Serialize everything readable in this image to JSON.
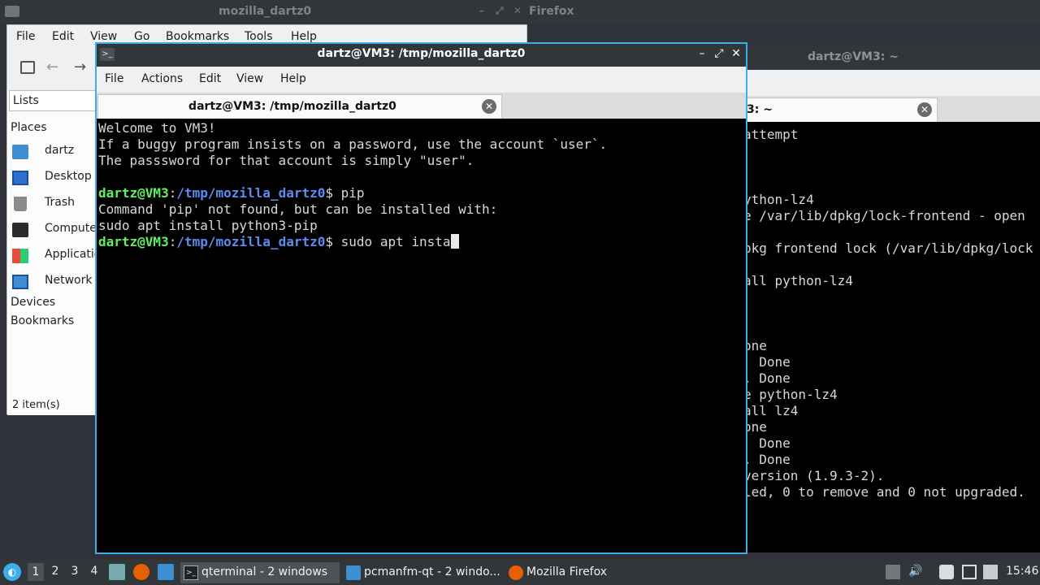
{
  "firefox": {
    "title": "mozilla_dartz0",
    "title_tail": "Firefox"
  },
  "file_manager": {
    "menu": [
      "File",
      "Edit",
      "View",
      "Go",
      "Bookmarks",
      "Tools",
      "Help"
    ],
    "sidebar_mode": "Lists",
    "places_header": "Places",
    "places": [
      {
        "label": "dartz",
        "icon": "home-folder-icon"
      },
      {
        "label": "Desktop",
        "icon": "desktop-icon"
      },
      {
        "label": "Trash",
        "icon": "trash-icon"
      },
      {
        "label": "Compute",
        "icon": "computer-icon"
      },
      {
        "label": "Applicatio",
        "icon": "applications-icon"
      },
      {
        "label": "Network",
        "icon": "network-icon"
      }
    ],
    "devices_header": "Devices",
    "bookmarks_header": "Bookmarks",
    "status": "2 item(s)"
  },
  "right_terminal": {
    "title": "dartz@VM3: ~",
    "tab_label": "3: ~",
    "lines": [
      {
        "text": "attempt",
        "row": 2
      },
      {
        "text": "ython-lz4",
        "row": 6
      },
      {
        "text": "e /var/lib/dpkg/lock-frontend - open",
        "row": 7
      },
      {
        "text": "pkg frontend lock (/var/lib/dpkg/lock",
        "row": 9
      },
      {
        "text": "all python-lz4",
        "row": 11
      },
      {
        "text": "one",
        "row": 15
      },
      {
        "text": "  Done",
        "row": 16
      },
      {
        "text": ". Done",
        "row": 17
      },
      {
        "text": "e python-lz4",
        "row": 18
      },
      {
        "text": "all lz4",
        "row": 19
      },
      {
        "text": "one",
        "row": 20
      },
      {
        "text": "  Done",
        "row": 21
      },
      {
        "text": ". Done",
        "row": 22
      },
      {
        "text": "version (1.9.3-2).",
        "row": 23
      },
      {
        "text": "led, 0 to remove and 0 not upgraded.",
        "row": 24
      }
    ]
  },
  "main_terminal": {
    "title": "dartz@VM3: /tmp/mozilla_dartz0",
    "menu": [
      "File",
      "Actions",
      "Edit",
      "View",
      "Help"
    ],
    "tab_label": "dartz@VM3: /tmp/mozilla_dartz0",
    "lines": [
      "Welcome to VM3!",
      "If a buggy program insists on a password, use the account `user`.",
      "The passsword for that account is simply \"user\".",
      "",
      "Command 'pip' not found, but can be installed with:",
      "sudo apt install python3-pip"
    ],
    "prompt_user": "dartz@VM3",
    "prompt_path": "/tmp/mozilla_dartz0",
    "prompt_symbol": "$",
    "cmd1": " pip",
    "cmd2": " sudo apt insta"
  },
  "taskbar": {
    "workspaces": [
      "1",
      "2",
      "3",
      "4"
    ],
    "active_workspace": "1",
    "tasks": [
      {
        "label": "qterminal - 2 windows",
        "icon": "terminal-icon"
      },
      {
        "label": "pcmanfm-qt - 2 windo...",
        "icon": "folder-icon"
      },
      {
        "label": "Mozilla Firefox",
        "icon": "firefox-icon"
      }
    ],
    "clock": "15:46"
  }
}
